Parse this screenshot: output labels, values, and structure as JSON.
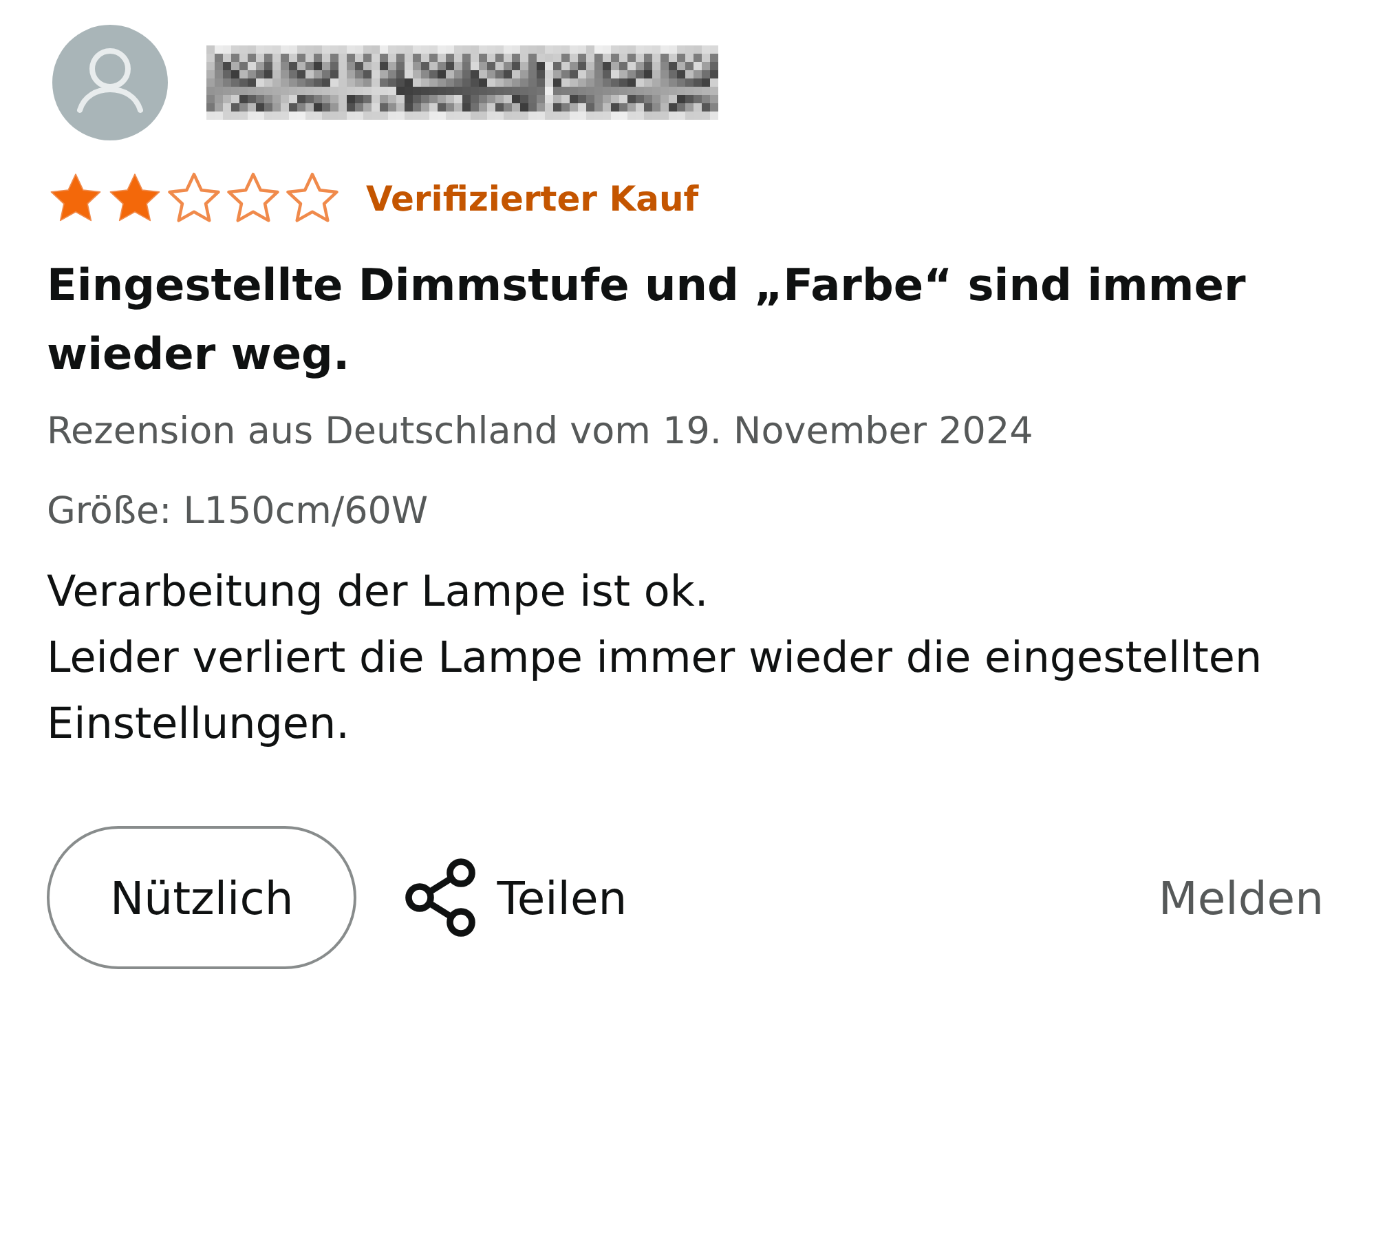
{
  "review": {
    "stars": 2,
    "verified_badge": "Verifizierter Kauf",
    "title": "Eingestellte Dimmstufe und „Farbe“ sind immer wieder weg.",
    "meta": "Rezension aus Deutschland vom 19. November 2024",
    "variant": "Größe: L150cm/60W",
    "body": [
      "Verarbeitung der Lampe ist ok.",
      "Leider verliert die Lampe immer wieder die eingestellten Einstellungen."
    ]
  },
  "actions": {
    "helpful": "Nützlich",
    "share": "Teilen",
    "report": "Melden"
  }
}
